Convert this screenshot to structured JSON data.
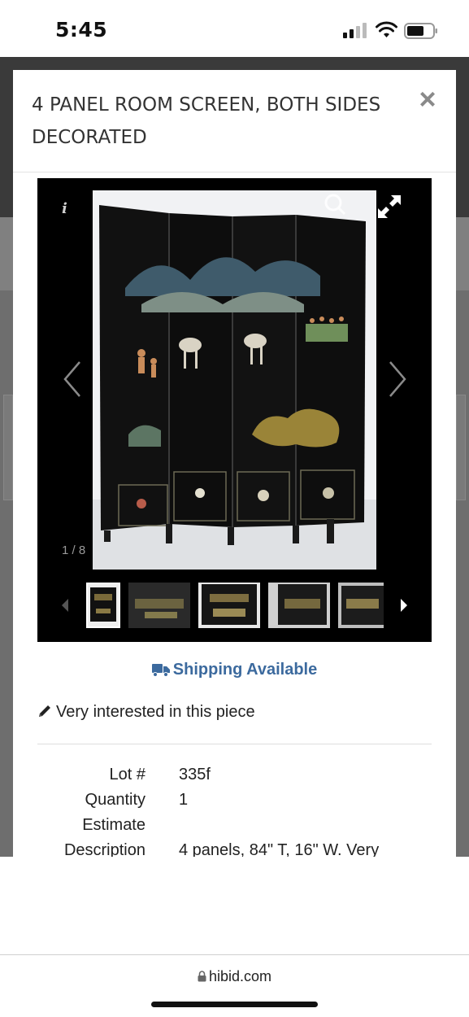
{
  "status_bar": {
    "time": "5:45"
  },
  "modal": {
    "title": "4 PANEL ROOM SCREEN, BOTH SIDES DECORATED",
    "close_icon": "×"
  },
  "gallery": {
    "info_label": "i",
    "counter": "1 / 8",
    "thumbnail_count": 5
  },
  "shipping_label": "Shipping Available",
  "note": "Very interested in this piece",
  "details": [
    {
      "label": "Lot #",
      "value": "335f"
    },
    {
      "label": "Quantity",
      "value": "1"
    },
    {
      "label": "Estimate",
      "value": ""
    },
    {
      "label": "Description",
      "value": "4 panels, 84\" T, 16\" W. Very"
    }
  ],
  "browser": {
    "url": "hibid.com"
  },
  "colors": {
    "accent": "#3c6a9e",
    "backdrop": "#6e6e6e",
    "gallery_bg": "#000000"
  }
}
